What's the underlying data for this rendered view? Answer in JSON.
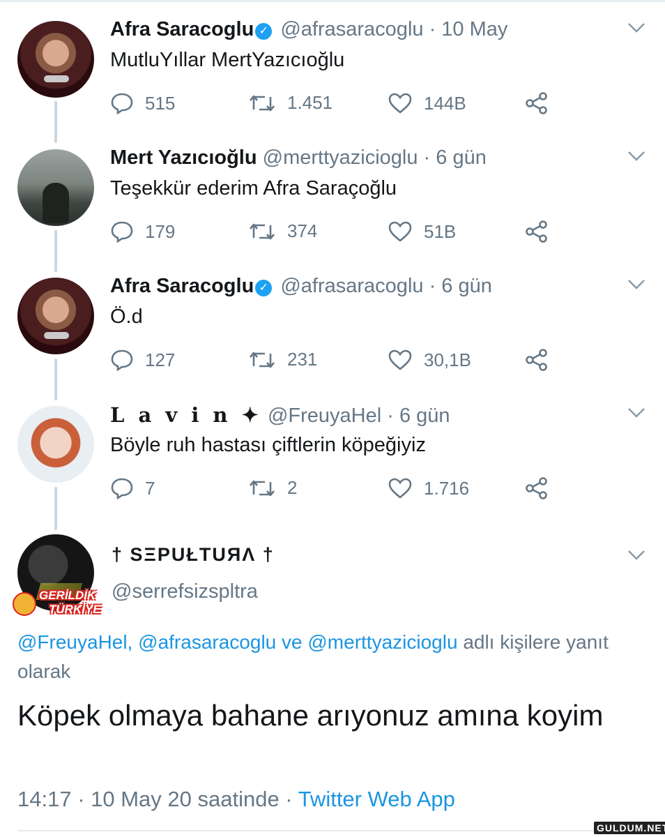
{
  "tweets": [
    {
      "name": "Afra Saracoglu",
      "verified": true,
      "handle": "@afrasaracoglu",
      "time": "· 10 May",
      "text": "MutluYıllar MertYazıcıoğlu",
      "replies": "515",
      "retweets": "1.451",
      "likes": "144B"
    },
    {
      "name": "Mert Yazıcıoğlu",
      "verified": false,
      "handle": "@merttyazicioglu",
      "time": "· 6 gün",
      "text": "Teşekkür ederim Afra Saraçoğlu",
      "replies": "179",
      "retweets": "374",
      "likes": "51B"
    },
    {
      "name": "Afra Saracoglu",
      "verified": true,
      "handle": "@afrasaracoglu",
      "time": "· 6 gün",
      "text": "Ö.d",
      "replies": "127",
      "retweets": "231",
      "likes": "30,1B"
    },
    {
      "name": "L a v i n ✦",
      "verified": false,
      "handle": "@FreuyaHel",
      "time": "· 6 gün",
      "text": "Böyle ruh hastası çiftlerin köpeğiyiz",
      "replies": "7",
      "retweets": "2",
      "likes": "1.716"
    }
  ],
  "main_tweet": {
    "name": "† SΞPUŁTUЯΛ †",
    "handle": "@serrefsizspltra",
    "avatar_sticker": {
      "line1": "GERİLDİK",
      "line2": "TÜRKİYE"
    },
    "reply_links": [
      "@FreuyaHel,",
      "@afrasaracoglu",
      "ve",
      "@merttyazicioglu"
    ],
    "reply_suffix": "adlı kişilere yanıt olarak",
    "text": "Köpek olmaya bahane arıyonuz amına koyim",
    "timestamp": "14:17 · 10 May 20 saatinde ·",
    "source": "Twitter Web App"
  },
  "watermark": "GULDUM.NET",
  "colors": {
    "link": "#1b95e0",
    "verified": "#1da1f2",
    "muted": "#657786",
    "thread": "#ccd6dd"
  },
  "icons": [
    "reply-icon",
    "retweet-icon",
    "like-icon",
    "share-icon",
    "chevron-down-icon",
    "verified-badge-icon"
  ]
}
